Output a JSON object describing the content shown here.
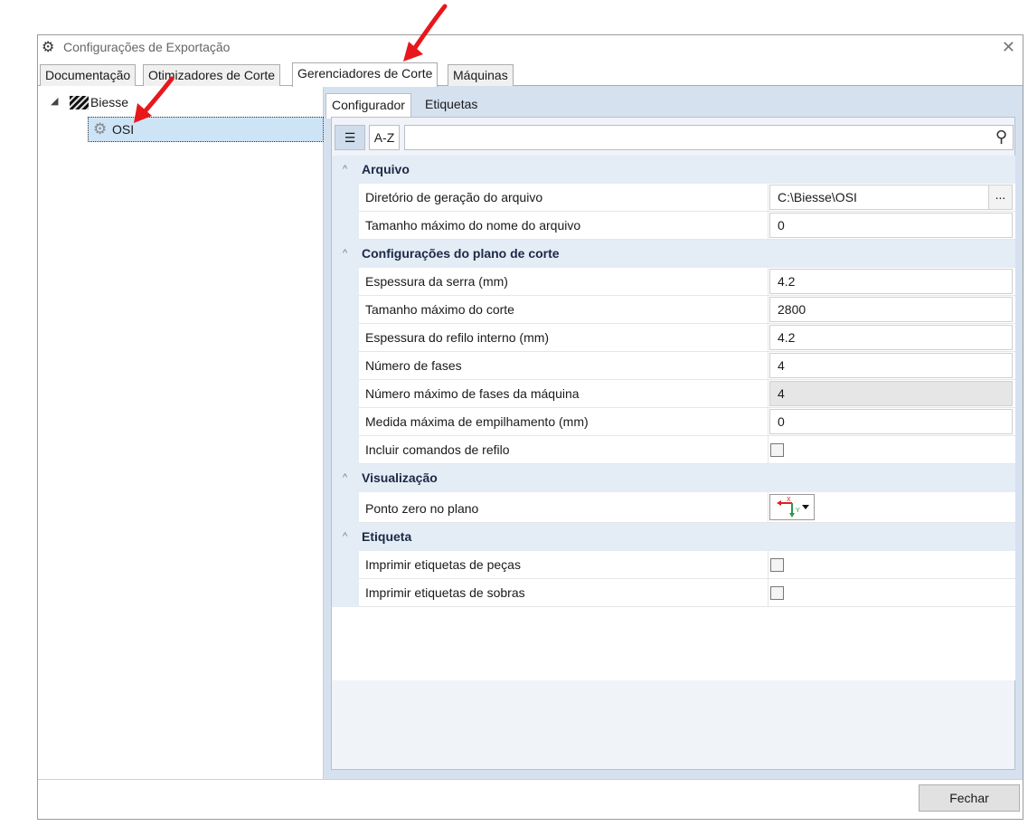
{
  "window": {
    "title": "Configurações de Exportação",
    "close_glyph": "✕",
    "title_icon": "gear-icon"
  },
  "main_tabs": [
    {
      "label": "Documentação",
      "active": false
    },
    {
      "label": "Otimizadores de Corte",
      "active": false
    },
    {
      "label": "Gerenciadores de Corte",
      "active": true
    },
    {
      "label": "Máquinas",
      "active": false
    }
  ],
  "tree": {
    "toggle": "◢",
    "root": {
      "label": "Biesse",
      "icon": "biesse-logo-icon"
    },
    "child": {
      "label": "OSI",
      "icon": "gear-icon",
      "selected": true
    }
  },
  "sub_tabs": [
    {
      "label": "Configurador",
      "active": true
    },
    {
      "label": "Etiquetas",
      "active": false
    }
  ],
  "toolbar": {
    "categorized_glyph": "☰",
    "alpha_label": "A-Z",
    "search_value": ""
  },
  "categories": [
    {
      "label": "Arquivo",
      "rows": [
        {
          "name": "Diretório de geração do arquivo",
          "value": "C:\\Biesse\\OSI",
          "browse": "..."
        },
        {
          "name": "Tamanho máximo do nome do arquivo",
          "value": "0"
        }
      ]
    },
    {
      "label": "Configurações do plano de corte",
      "rows": [
        {
          "name": "Espessura da serra (mm)",
          "value": "4.2"
        },
        {
          "name": "Tamanho máximo do corte",
          "value": "2800"
        },
        {
          "name": "Espessura do refilo interno (mm)",
          "value": "4.2"
        },
        {
          "name": "Número de fases",
          "value": "4"
        },
        {
          "name": "Número máximo de fases da máquina",
          "value": "4",
          "readonly": true
        },
        {
          "name": "Medida máxima de empilhamento (mm)",
          "value": "0"
        },
        {
          "name": "Incluir comandos de refilo",
          "checked": false
        }
      ]
    },
    {
      "label": "Visualização",
      "rows": [
        {
          "name": "Ponto zero no plano",
          "axis_x": "X",
          "axis_y": "Y"
        }
      ]
    },
    {
      "label": "Etiqueta",
      "rows": [
        {
          "name": "Imprimir etiquetas de peças",
          "checked": false
        },
        {
          "name": "Imprimir etiquetas de sobras",
          "checked": false
        }
      ]
    }
  ],
  "footer": {
    "close_label": "Fechar"
  },
  "colors": {
    "annotation_arrow": "#e8171b",
    "selection": "#cde4f7",
    "category_bg": "#e4ecf6"
  }
}
